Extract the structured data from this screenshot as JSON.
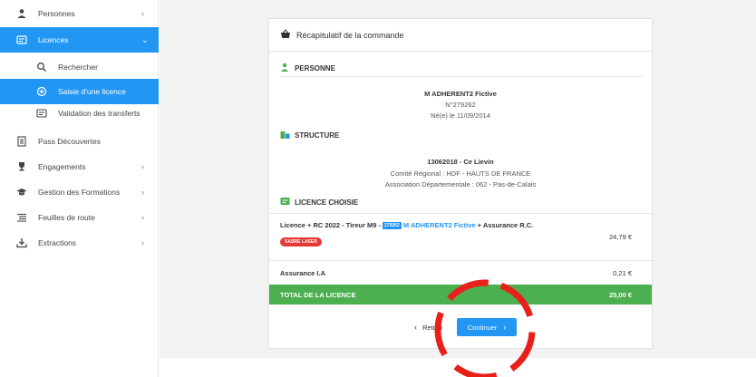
{
  "sidebar": {
    "items": [
      {
        "label": "Personnes",
        "icon": "user-group-icon",
        "has_chevron": true,
        "chevron": "›"
      },
      {
        "label": "Licences",
        "icon": "id-card-icon",
        "has_chevron": true,
        "chevron": "⌄"
      },
      {
        "label": "Rechercher",
        "icon": "search-icon"
      },
      {
        "label": "Saisie d'une licence",
        "icon": "plus-circle-icon"
      },
      {
        "label": "Validation des transferts",
        "icon": "transfer-icon"
      },
      {
        "label": "Pass Découvertes",
        "icon": "document-icon"
      },
      {
        "label": "Engagements",
        "icon": "trophy-icon",
        "has_chevron": true,
        "chevron": "›"
      },
      {
        "label": "Gestion des Formations",
        "icon": "graduation-cap-icon",
        "has_chevron": true,
        "chevron": "›"
      },
      {
        "label": "Feuilles de route",
        "icon": "list-icon",
        "has_chevron": true,
        "chevron": "›"
      },
      {
        "label": "Extractions",
        "icon": "download-icon",
        "has_chevron": true,
        "chevron": "›"
      }
    ]
  },
  "card": {
    "header_title": "Récapitulatif de la commande",
    "personne": {
      "section_title": "PERSONNE",
      "name": "M ADHERENT2 Fictive",
      "number": "N°279262",
      "birth": "Né(e) le 11/09/2014"
    },
    "structure": {
      "section_title": "STRUCTURE",
      "name": "13062018 - Ce Lievin",
      "comite": "Comité Régional : HDF - HAUTS DE FRANCE",
      "association": "Association Départementale : 062 - Pas-de-Calais"
    },
    "licence": {
      "section_title": "LICENCE CHOISIE",
      "line_prefix": "Licence + RC 2022 - Tireur M9 - ",
      "id_badge": "279262",
      "person_link": "M ADHERENT2 Fictive",
      "line_suffix": " + Assurance R.C.",
      "weapon_badge": "SABRE LASER",
      "price": "24,79 €",
      "insurance_label": "Assurance I.A",
      "insurance_price": "0,21 €",
      "total_label": "TOTAL DE LA LICENCE",
      "total_price": "25,00 €"
    },
    "back_label": "Retour",
    "continue_label": "Continuer"
  },
  "colors": {
    "accent": "#2196f3",
    "total_bar": "#4caf50",
    "badge_red": "#e53935",
    "annotation": "#e8201a"
  }
}
